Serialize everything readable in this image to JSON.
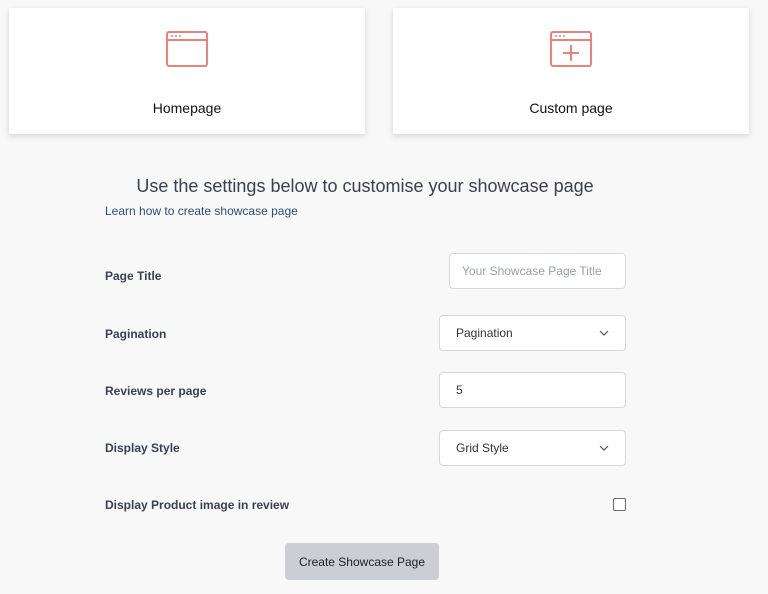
{
  "cards": [
    {
      "label": "Homepage",
      "icon": "browser-window-icon"
    },
    {
      "label": "Custom page",
      "icon": "browser-window-plus-icon"
    }
  ],
  "accent_color": "#e8827a",
  "heading": "Use the settings below to customise your showcase page",
  "learn_link": "Learn how to create showcase page",
  "form": {
    "page_title": {
      "label": "Page Title",
      "placeholder": "Your Showcase Page Title",
      "value": ""
    },
    "pagination": {
      "label": "Pagination",
      "selected": "Pagination"
    },
    "reviews_per_page": {
      "label": "Reviews per page",
      "value": "5"
    },
    "display_style": {
      "label": "Display Style",
      "selected": "Grid Style"
    },
    "display_product_image": {
      "label": "Display Product image in review",
      "checked": false
    }
  },
  "create_button": "Create Showcase Page"
}
